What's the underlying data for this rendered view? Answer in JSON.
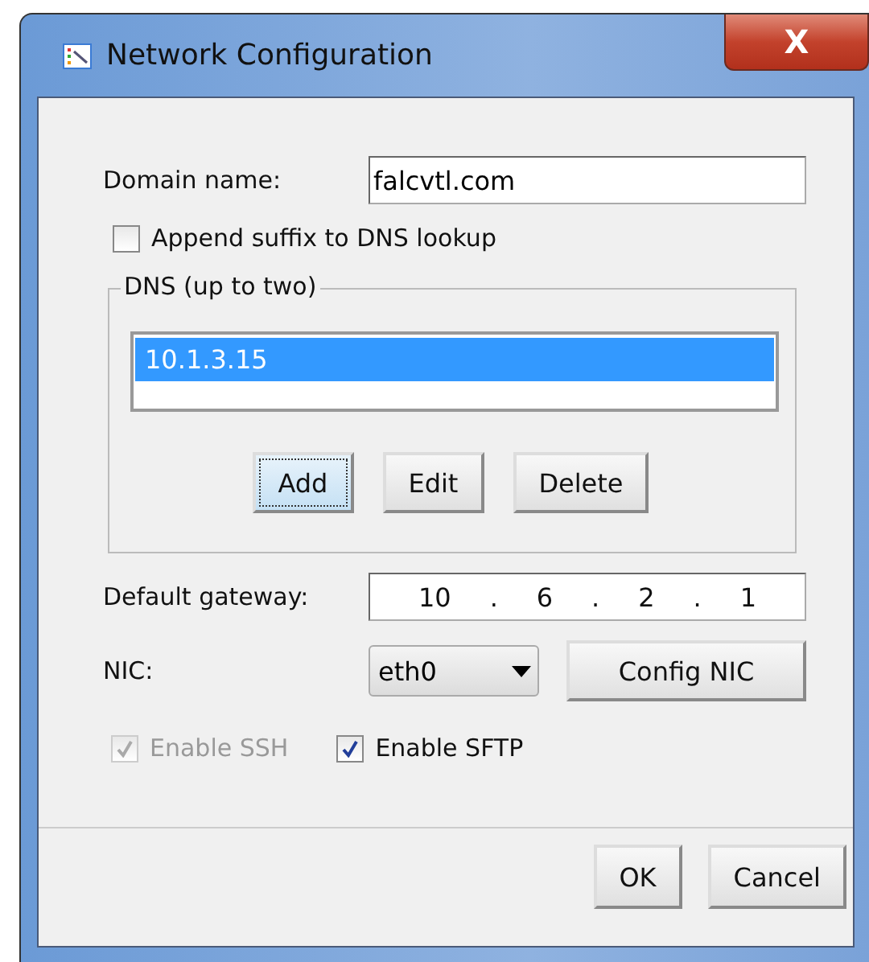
{
  "window": {
    "title": "Network Configuration",
    "close": "X"
  },
  "domain": {
    "label": "Domain name:",
    "value": "falcvtl.com"
  },
  "append_suffix": {
    "label": "Append suffix to DNS lookup",
    "checked": false
  },
  "dns": {
    "legend": "DNS (up to two)",
    "entries": [
      {
        "text": "10.1.3.15",
        "selected": true
      }
    ],
    "buttons": [
      {
        "label": "Add",
        "focused": true
      },
      {
        "label": "Edit",
        "focused": false
      },
      {
        "label": "Delete",
        "focused": false
      }
    ]
  },
  "gateway": {
    "label": "Default gateway:",
    "parts": [
      "10",
      ".",
      "6",
      ".",
      "2",
      ".",
      "1"
    ]
  },
  "nic": {
    "label": "NIC:",
    "value": "eth0",
    "button": "Config NIC"
  },
  "options": [
    {
      "label": "Enable SSH",
      "checked": true,
      "disabled": true
    },
    {
      "label": "Enable SFTP",
      "checked": true,
      "disabled": false
    }
  ],
  "buttons": [
    "OK",
    "Cancel"
  ]
}
